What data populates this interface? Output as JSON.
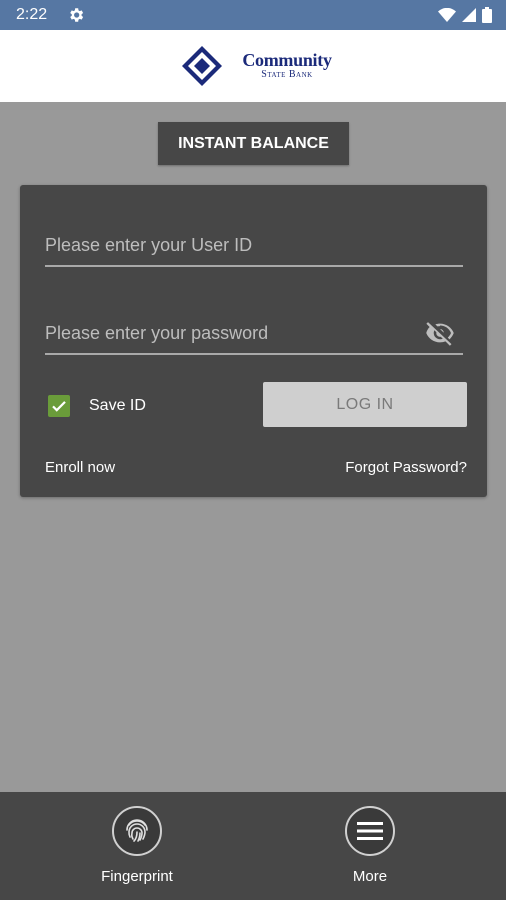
{
  "status_bar": {
    "time": "2:22"
  },
  "header": {
    "logo_line1": "Community",
    "logo_line2": "State Bank"
  },
  "instant_balance": {
    "label": "INSTANT BALANCE"
  },
  "login": {
    "user_id_placeholder": "Please enter your User ID",
    "password_placeholder": "Please enter your password",
    "save_id_label": "Save ID",
    "save_id_checked": true,
    "login_button": "LOG IN",
    "enroll_link": "Enroll now",
    "forgot_link": "Forgot Password?"
  },
  "bottom_nav": {
    "items": [
      {
        "label": "Fingerprint",
        "icon": "fingerprint-icon"
      },
      {
        "label": "More",
        "icon": "menu-icon"
      }
    ]
  },
  "colors": {
    "status_bar": "#5677a3",
    "background": "#999999",
    "panel": "#474747",
    "checkbox": "#6a9c3a",
    "logo_blue": "#1b2a7a"
  }
}
